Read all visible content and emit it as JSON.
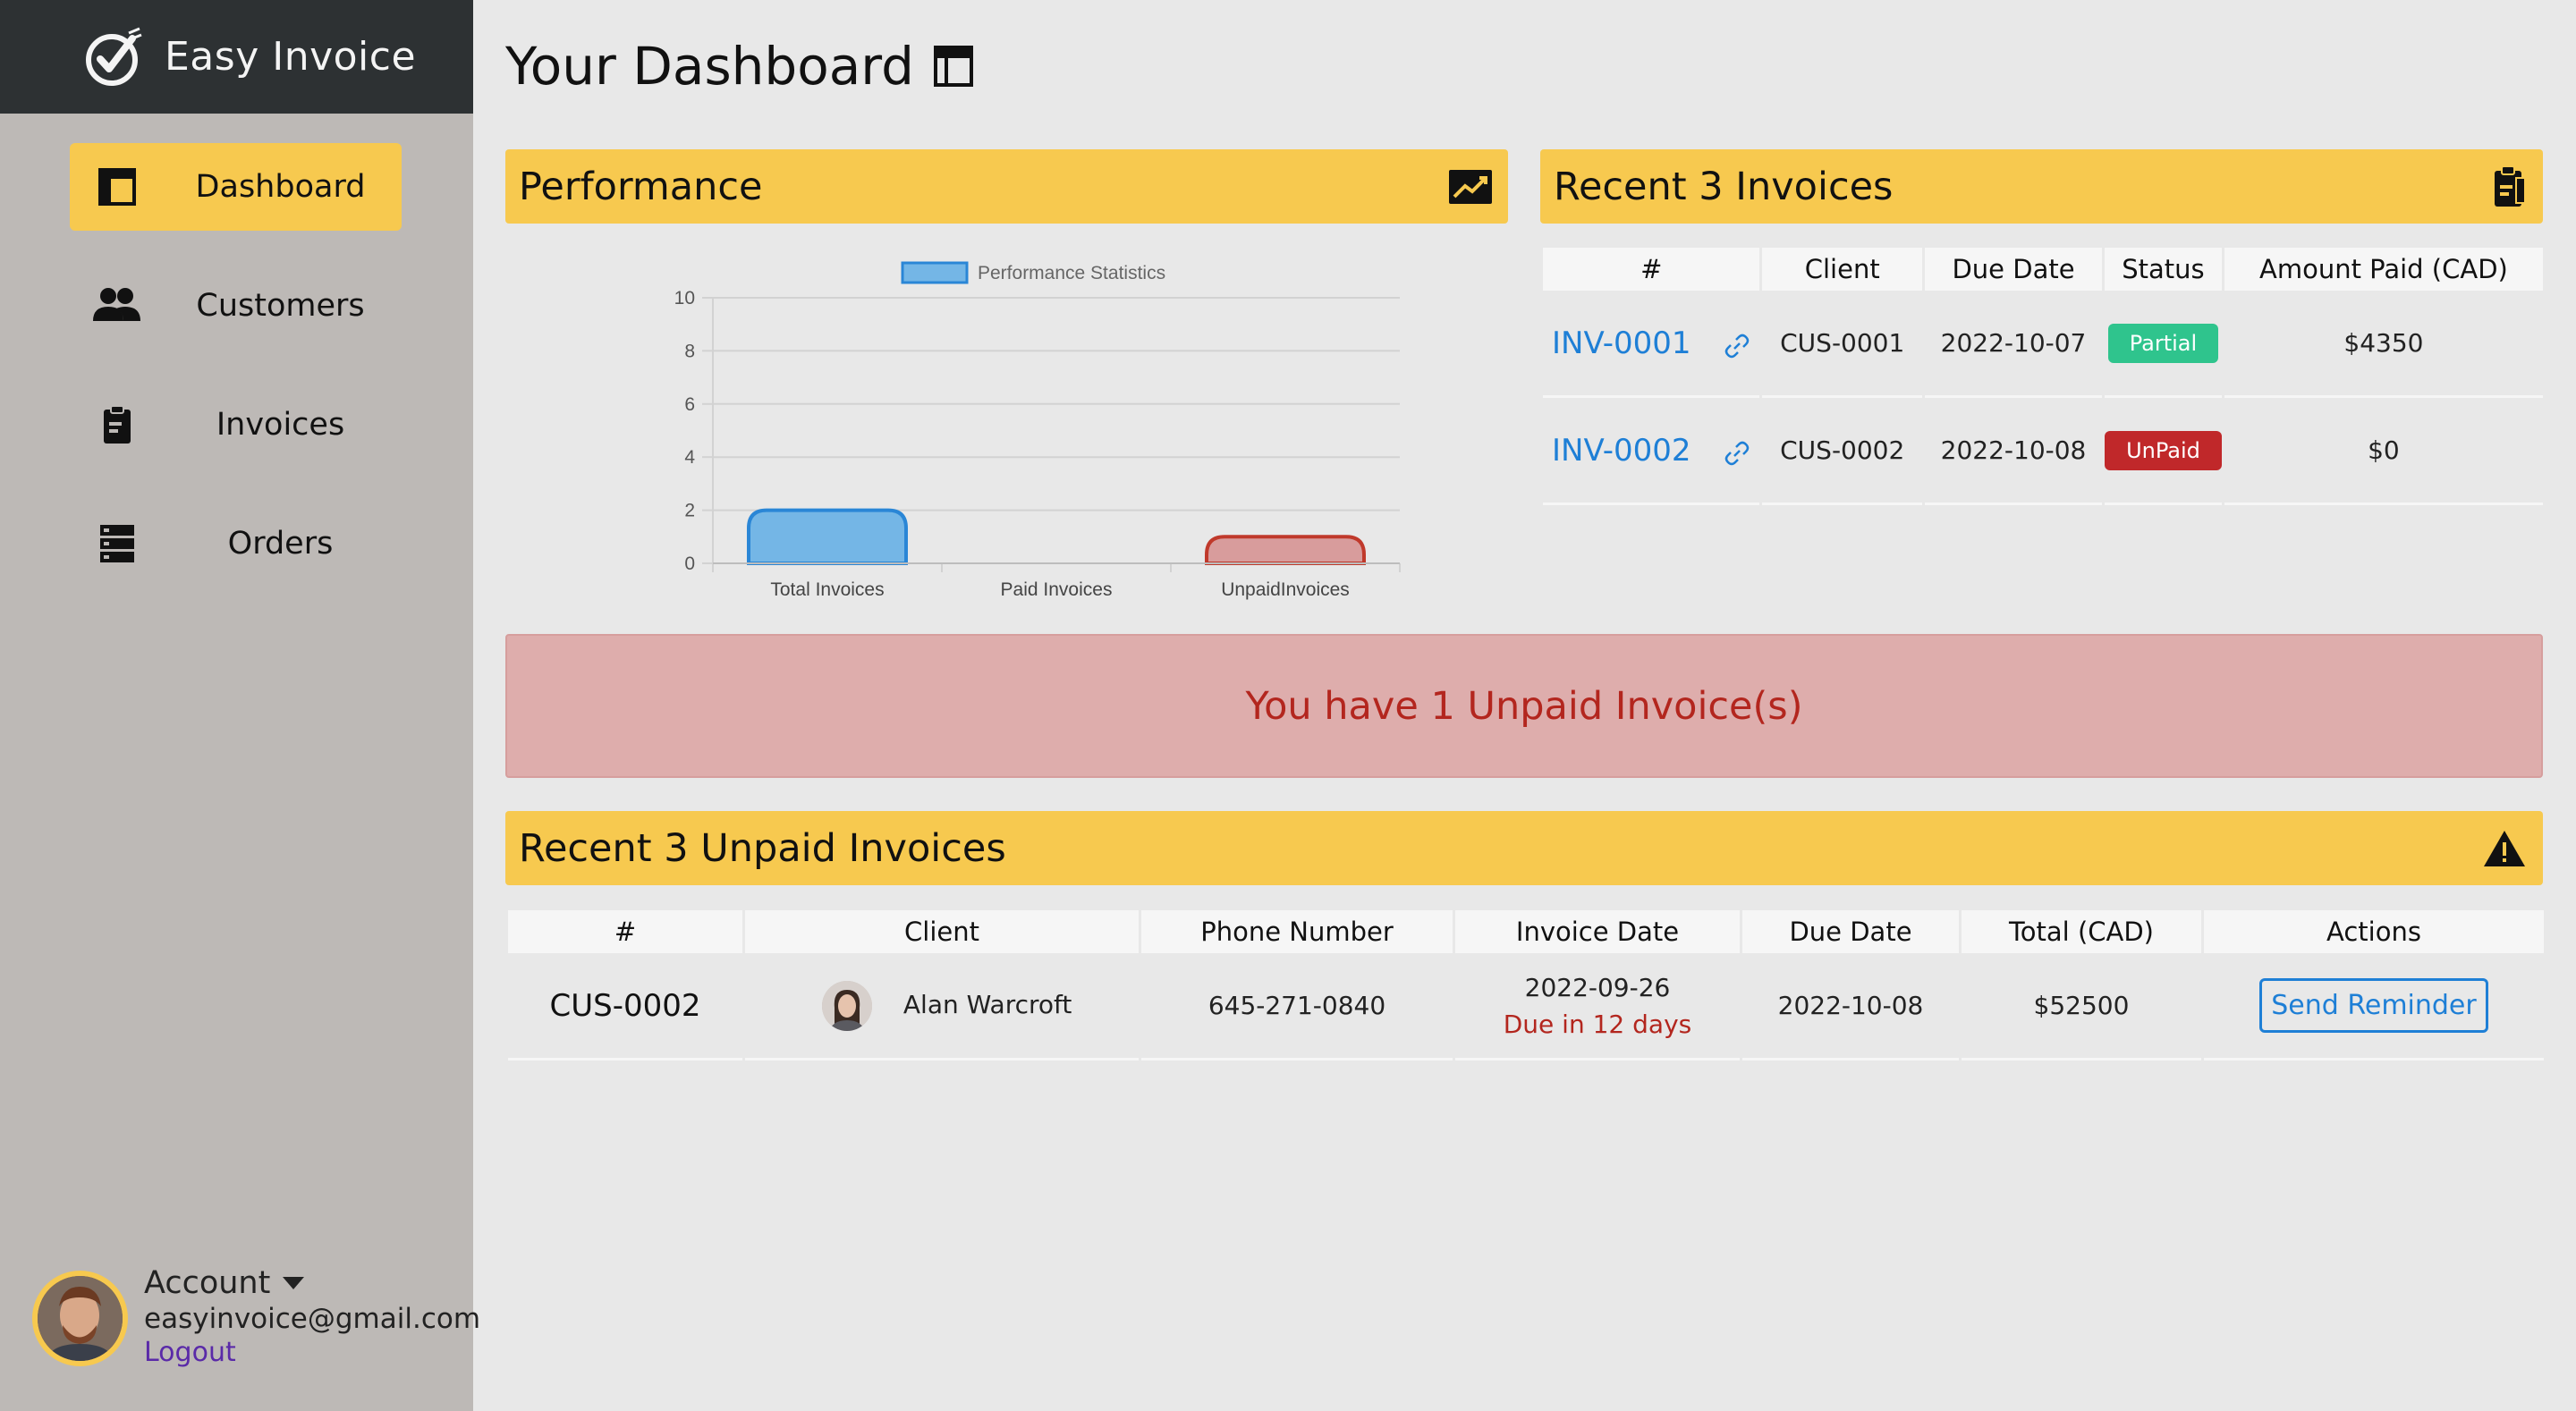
{
  "brand": {
    "name": "Easy Invoice"
  },
  "sidebar": {
    "items": [
      {
        "label": "Dashboard",
        "icon": "dashboard-icon",
        "active": true
      },
      {
        "label": "Customers",
        "icon": "users-icon",
        "active": false
      },
      {
        "label": "Invoices",
        "icon": "clipboard-icon",
        "active": false
      },
      {
        "label": "Orders",
        "icon": "server-icon",
        "active": false
      }
    ],
    "account": {
      "title": "Account",
      "email": "easyinvoice@gmail.com",
      "logout": "Logout"
    }
  },
  "page": {
    "title": "Your Dashboard"
  },
  "performance": {
    "title": "Performance"
  },
  "chart_data": {
    "type": "bar",
    "categories": [
      "Total Invoices",
      "Paid Invoices",
      "UnpaidInvoices"
    ],
    "series": [
      {
        "name": "Performance Statistics",
        "values": [
          2,
          0,
          1
        ]
      }
    ],
    "ylim": [
      0,
      10
    ],
    "yticks": [
      0,
      2,
      4,
      6,
      8,
      10
    ],
    "legend": "top",
    "grid": true,
    "colors": {
      "fills": [
        "#74b6e6",
        "#74b6e6",
        "#d89c9c"
      ],
      "strokes": [
        "#2a86d6",
        "#2a86d6",
        "#c0392b"
      ]
    }
  },
  "recent": {
    "title": "Recent 3 Invoices",
    "headers": [
      "#",
      "Client",
      "Due Date",
      "Status",
      "Amount Paid (CAD)"
    ],
    "rows": [
      {
        "id": "INV-0001",
        "client": "CUS-0001",
        "due": "2022-10-07",
        "status": "Partial",
        "status_color": "#2fc48d",
        "amount": "$4350"
      },
      {
        "id": "INV-0002",
        "client": "CUS-0002",
        "due": "2022-10-08",
        "status": "UnPaid",
        "status_color": "#c0282a",
        "amount": "$0"
      }
    ]
  },
  "alert": {
    "text": "You have 1 Unpaid Invoice(s)"
  },
  "unpaid": {
    "title": "Recent 3 Unpaid Invoices",
    "headers": [
      "#",
      "Client",
      "Phone Number",
      "Invoice Date",
      "Due Date",
      "Total (CAD)",
      "Actions"
    ],
    "rows": [
      {
        "id": "CUS-0002",
        "client": "Alan Warcroft",
        "phone": "645-271-0840",
        "invoice_date": "2022-09-26",
        "due_note": "Due in 12 days",
        "due": "2022-10-08",
        "total": "$52500",
        "action": "Send Reminder"
      }
    ]
  },
  "colors": {
    "accent": "#f7c94f",
    "sidebar": "#bdb9b6",
    "brand_bar": "#2d3133",
    "link": "#1e7fd6",
    "danger": "#b3261e"
  }
}
